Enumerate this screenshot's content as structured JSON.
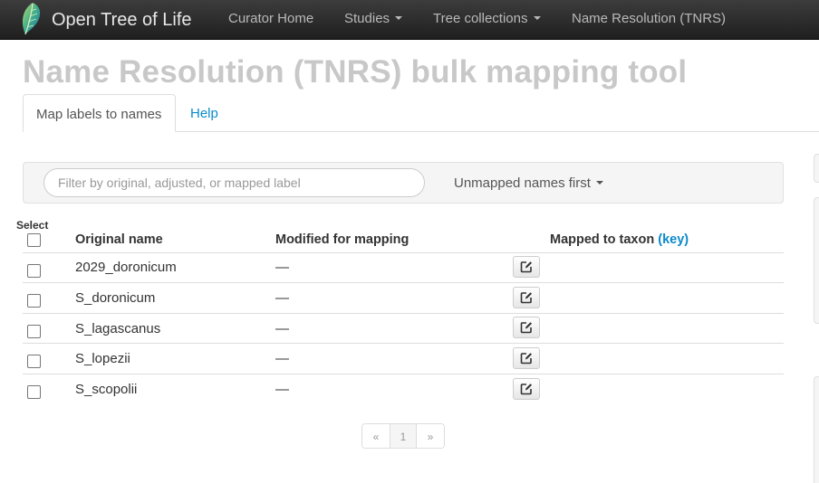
{
  "navbar": {
    "brand": "Open Tree of Life",
    "items": [
      {
        "label": "Curator Home",
        "dropdown": false
      },
      {
        "label": "Studies",
        "dropdown": true
      },
      {
        "label": "Tree collections",
        "dropdown": true
      },
      {
        "label": "Name Resolution (TNRS)",
        "dropdown": false
      }
    ]
  },
  "page": {
    "title": "Name Resolution (TNRS) bulk mapping tool"
  },
  "tabs": [
    {
      "label": "Map labels to names",
      "active": true
    },
    {
      "label": "Help",
      "active": false
    }
  ],
  "filter": {
    "placeholder": "Filter by original, adjusted, or mapped label",
    "value": "",
    "sort_label": "Unmapped names first"
  },
  "table": {
    "select_label": "Select",
    "columns": {
      "original": "Original name",
      "modified": "Modified for mapping",
      "mapped": "Mapped to taxon",
      "mapped_key": "(key)"
    },
    "rows": [
      {
        "original": "2029_doronicum",
        "modified": "—",
        "mapped": ""
      },
      {
        "original": "S_doronicum",
        "modified": "—",
        "mapped": ""
      },
      {
        "original": "S_lagascanus",
        "modified": "—",
        "mapped": ""
      },
      {
        "original": "S_lopezii",
        "modified": "—",
        "mapped": ""
      },
      {
        "original": "S_scopolii",
        "modified": "—",
        "mapped": ""
      }
    ]
  },
  "pagination": {
    "prev": "«",
    "current": "1",
    "next": "»"
  },
  "colors": {
    "accent": "#0a8acb",
    "navbar": "#222222",
    "title": "#c8c8c8"
  }
}
